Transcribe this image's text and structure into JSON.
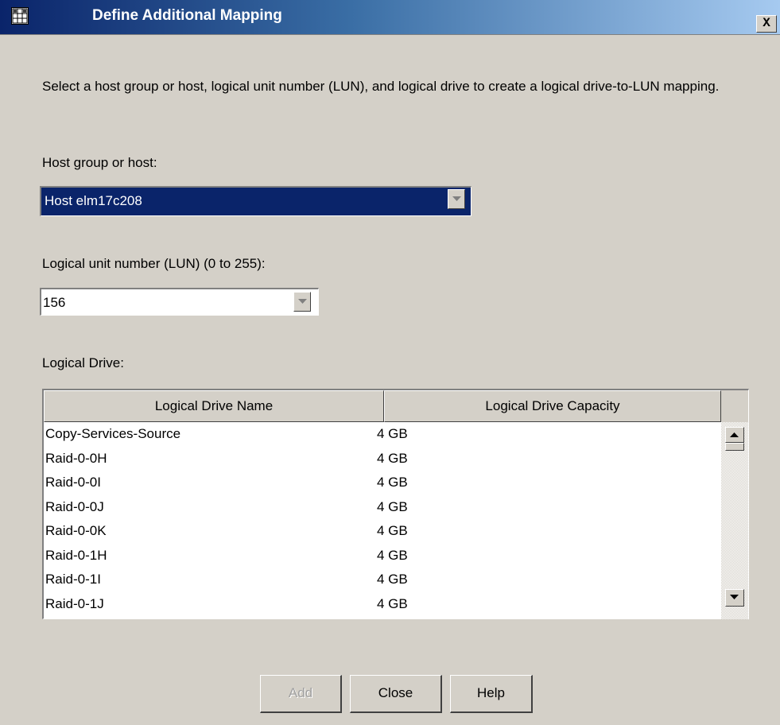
{
  "window": {
    "title": "Define Additional Mapping",
    "close_label": "X"
  },
  "instruction": "Select a host group or host, logical unit number (LUN), and logical drive to create a logical drive-to-LUN mapping.",
  "host": {
    "label": "Host group or host:",
    "selected": "Host elm17c208"
  },
  "lun": {
    "label": "Logical unit number (LUN) (0 to 255):",
    "value": "156"
  },
  "drives": {
    "label": "Logical Drive:",
    "columns": [
      "Logical Drive Name",
      "Logical Drive Capacity"
    ],
    "rows": [
      {
        "name": "Copy-Services-Source",
        "capacity": "4 GB"
      },
      {
        "name": "Raid-0-0H",
        "capacity": "4 GB"
      },
      {
        "name": "Raid-0-0I",
        "capacity": "4 GB"
      },
      {
        "name": "Raid-0-0J",
        "capacity": "4 GB"
      },
      {
        "name": "Raid-0-0K",
        "capacity": "4 GB"
      },
      {
        "name": "Raid-0-1H",
        "capacity": "4 GB"
      },
      {
        "name": "Raid-0-1I",
        "capacity": "4 GB"
      },
      {
        "name": "Raid-0-1J",
        "capacity": "4 GB"
      }
    ]
  },
  "buttons": {
    "add": "Add",
    "close": "Close",
    "help": "Help"
  },
  "colors": {
    "window_bg": "#d4d0c8",
    "title_start": "#0a246a",
    "title_end": "#a6caf0",
    "selection_bg": "#0a246a"
  },
  "icons": {
    "app": "grid-table-icon",
    "dropdown": "triangle-down-icon",
    "scroll_up": "triangle-up-icon",
    "scroll_down": "triangle-down-icon"
  }
}
